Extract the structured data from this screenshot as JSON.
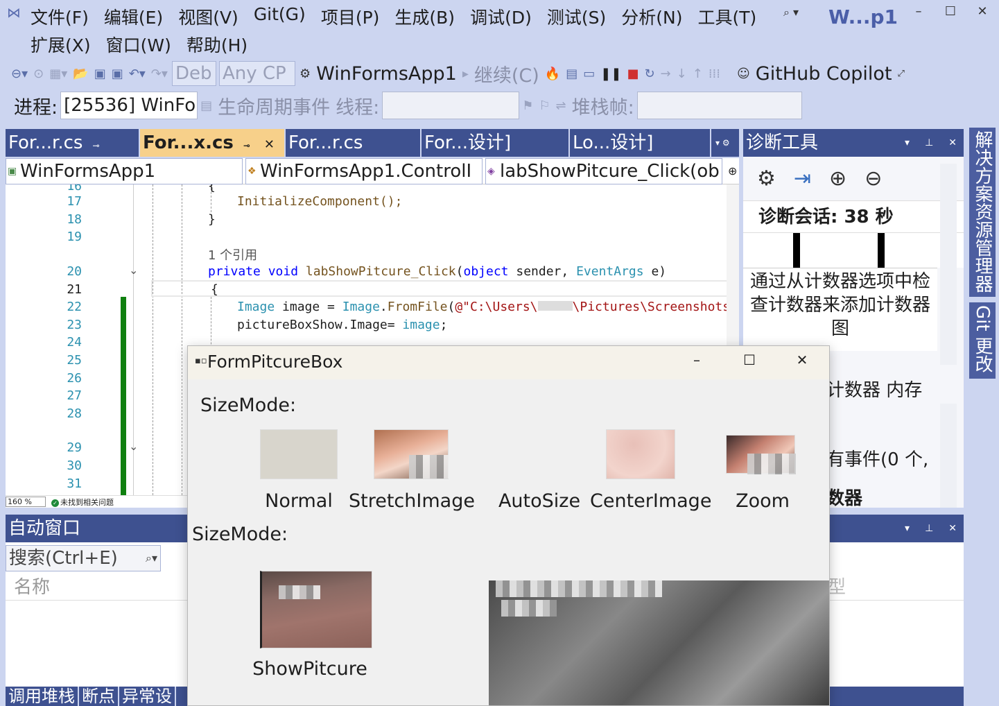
{
  "menu": {
    "row1": [
      "文件(F)",
      "编辑(E)",
      "视图(V)",
      "Git(G)",
      "项目(P)",
      "生成(B)",
      "调试(D)",
      "测试(S)",
      "分析(N)",
      "工具(T)"
    ],
    "row2": [
      "扩展(X)",
      "窗口(W)",
      "帮助(H)"
    ],
    "window_title": "W...p1"
  },
  "toolbar1": {
    "config": "Deb",
    "platform": "Any CP",
    "project": "WinFormsApp1",
    "continue": "继续(C)",
    "copilot": "GitHub Copilot"
  },
  "toolbar2": {
    "process_label": "进程:",
    "process_value": "[25536] WinFo",
    "lifecycle": "生命周期事件",
    "thread_label": "线程:",
    "stack_label": "堆栈帧:"
  },
  "tabs": [
    {
      "label": "For...r.cs"
    },
    {
      "label": "For...x.cs"
    },
    {
      "label": "For...r.cs"
    },
    {
      "label": "For...设计]"
    },
    {
      "label": "Lo...设计]"
    }
  ],
  "nav": {
    "project": "WinFormsApp1",
    "class": "WinFormsApp1.ControlI",
    "member": "labShowPitcure_Click(ob"
  },
  "editor": {
    "lines": [
      {
        "num": "16",
        "code": "{"
      },
      {
        "num": "17",
        "code": "InitializeComponent();"
      },
      {
        "num": "18",
        "code": "}"
      },
      {
        "num": "19",
        "code": ""
      },
      {
        "num": "20",
        "code": "private void labShowPitcure_Click(object sender, EventArgs e)"
      },
      {
        "num": "21",
        "code": "{"
      },
      {
        "num": "22",
        "code": "Image image = Image.FromFile(@\"C:\\Users\\"
      },
      {
        "num": "23",
        "code": "pictureBoxShow.Image= image;"
      },
      {
        "num": "24",
        "code": ""
      },
      {
        "num": "25",
        "code": ""
      },
      {
        "num": "26",
        "code": ""
      },
      {
        "num": "27",
        "code": ""
      },
      {
        "num": "28",
        "code": ""
      },
      {
        "num": "29",
        "code": ""
      },
      {
        "num": "30",
        "code": ""
      },
      {
        "num": "31",
        "code": ""
      }
    ],
    "code_ref": "1 个引用",
    "path_tail": "\\Pictures\\Screenshots\\",
    "zoom": "160 %",
    "status": "未找到相关问题"
  },
  "diag": {
    "title": "诊断工具",
    "session": "诊断会话: 38 秒",
    "message": "通过从计数器选项中检查计数器来添加计数器图",
    "tabs_text": "计数器  内存",
    "events_text": "有事件(0 个,",
    "counter_text": "数器"
  },
  "auto": {
    "title": "自动窗口",
    "search_placeholder": "搜索(Ctrl+E)",
    "col_name": "名称",
    "col_type": "型"
  },
  "bottom_tabs": [
    "调用堆栈",
    "断点",
    "异常设"
  ],
  "vtabs": [
    "解决方案资源管理器",
    "Git 更改"
  ],
  "form": {
    "title": "FormPitcureBox",
    "sizemode1": "SizeMode:",
    "sizemode2": "SizeMode:",
    "thumbs": [
      "Normal",
      "StretchImage",
      "AutoSize",
      "CenterImage",
      "Zoom"
    ],
    "show_label": "ShowPitcure"
  }
}
